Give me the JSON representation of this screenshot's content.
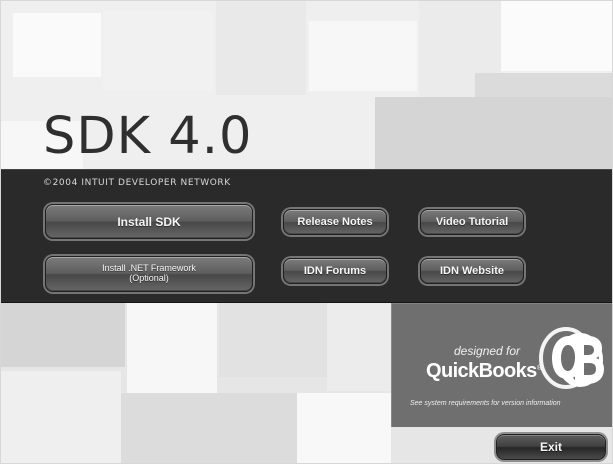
{
  "branding": {
    "title": "SDK 4.0",
    "copyright": "©2004 INTUIT DEVELOPER NETWORK"
  },
  "buttons": {
    "install_sdk": "Install SDK",
    "install_net_line1": "Install .NET Framework",
    "install_net_line2": "(Optional)",
    "release_notes": "Release Notes",
    "video_tutorial": "Video Tutorial",
    "idn_forums": "IDN Forums",
    "idn_website": "IDN Website",
    "exit": "Exit"
  },
  "quickbooks": {
    "designed_for": "designed for",
    "brand": "QuickBooks",
    "registered_mark": "®",
    "caption": "See system requirements for version information"
  },
  "colors": {
    "band": "#2a2a2a",
    "qb_panel": "#6f6f6f"
  },
  "icons": {
    "quickbooks_logo": "qb-logo-icon"
  }
}
